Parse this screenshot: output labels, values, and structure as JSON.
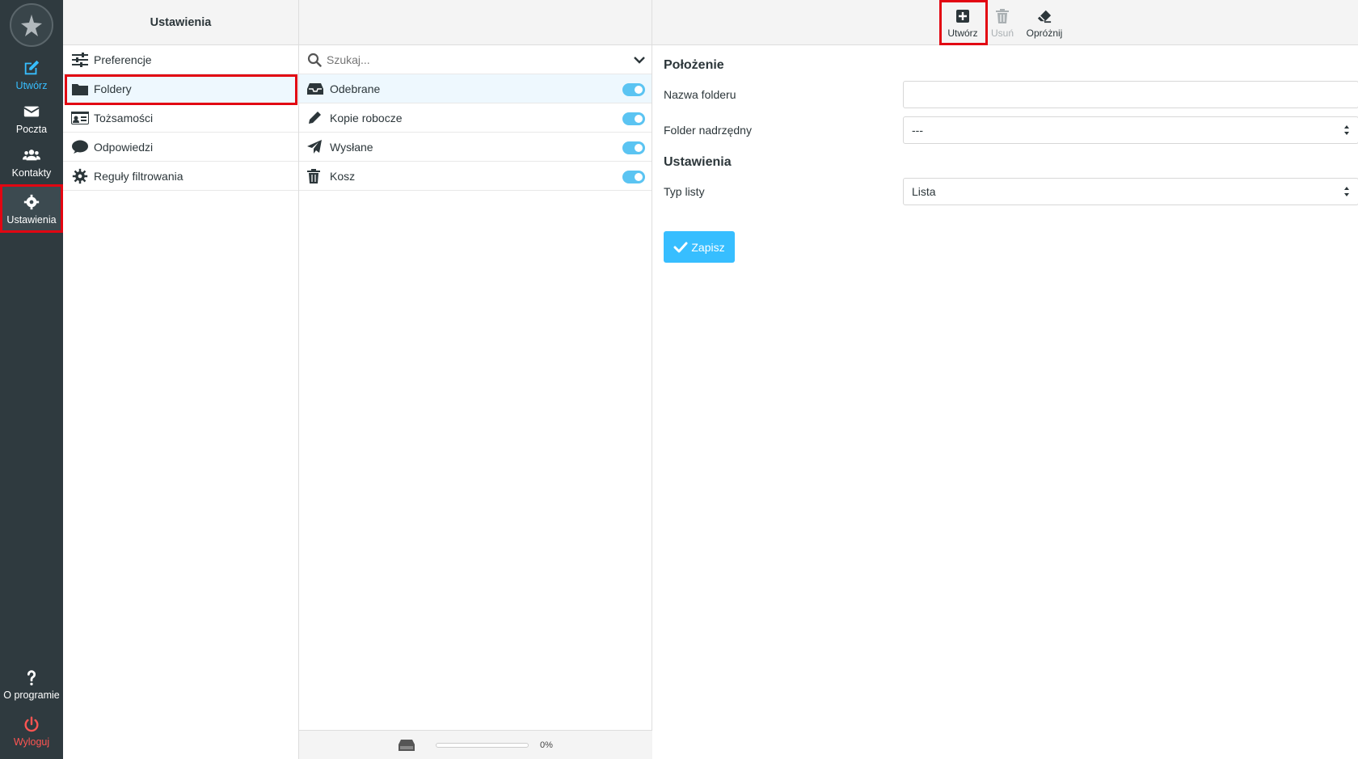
{
  "nav": {
    "compose": "Utwórz",
    "mail": "Poczta",
    "contacts": "Kontakty",
    "settings": "Ustawienia",
    "about": "O programie",
    "logout": "Wyloguj"
  },
  "settings_panel": {
    "title": "Ustawienia",
    "items": [
      "Preferencje",
      "Foldery",
      "Tożsamości",
      "Odpowiedzi",
      "Reguły filtrowania"
    ],
    "selected": "Foldery"
  },
  "folders_panel": {
    "search_placeholder": "Szukaj...",
    "folders": [
      {
        "name": "Odebrane",
        "subscribed": true
      },
      {
        "name": "Kopie robocze",
        "subscribed": true
      },
      {
        "name": "Wysłane",
        "subscribed": true
      },
      {
        "name": "Kosz",
        "subscribed": true
      }
    ],
    "quota_text": "0%",
    "quota_value": 0
  },
  "toolbar": {
    "create": "Utwórz",
    "delete": "Usuń",
    "empty": "Opróżnij"
  },
  "form": {
    "section_location": "Położenie",
    "folder_name_label": "Nazwa folderu",
    "folder_name_value": "",
    "parent_label": "Folder nadrzędny",
    "parent_value": "---",
    "section_settings": "Ustawienia",
    "list_type_label": "Typ listy",
    "list_type_value": "Lista",
    "save": "Zapisz"
  },
  "colors": {
    "accent": "#37beff",
    "nav_bg": "#2f3a3f",
    "highlight": "#e20612",
    "logout": "#ff5552"
  }
}
